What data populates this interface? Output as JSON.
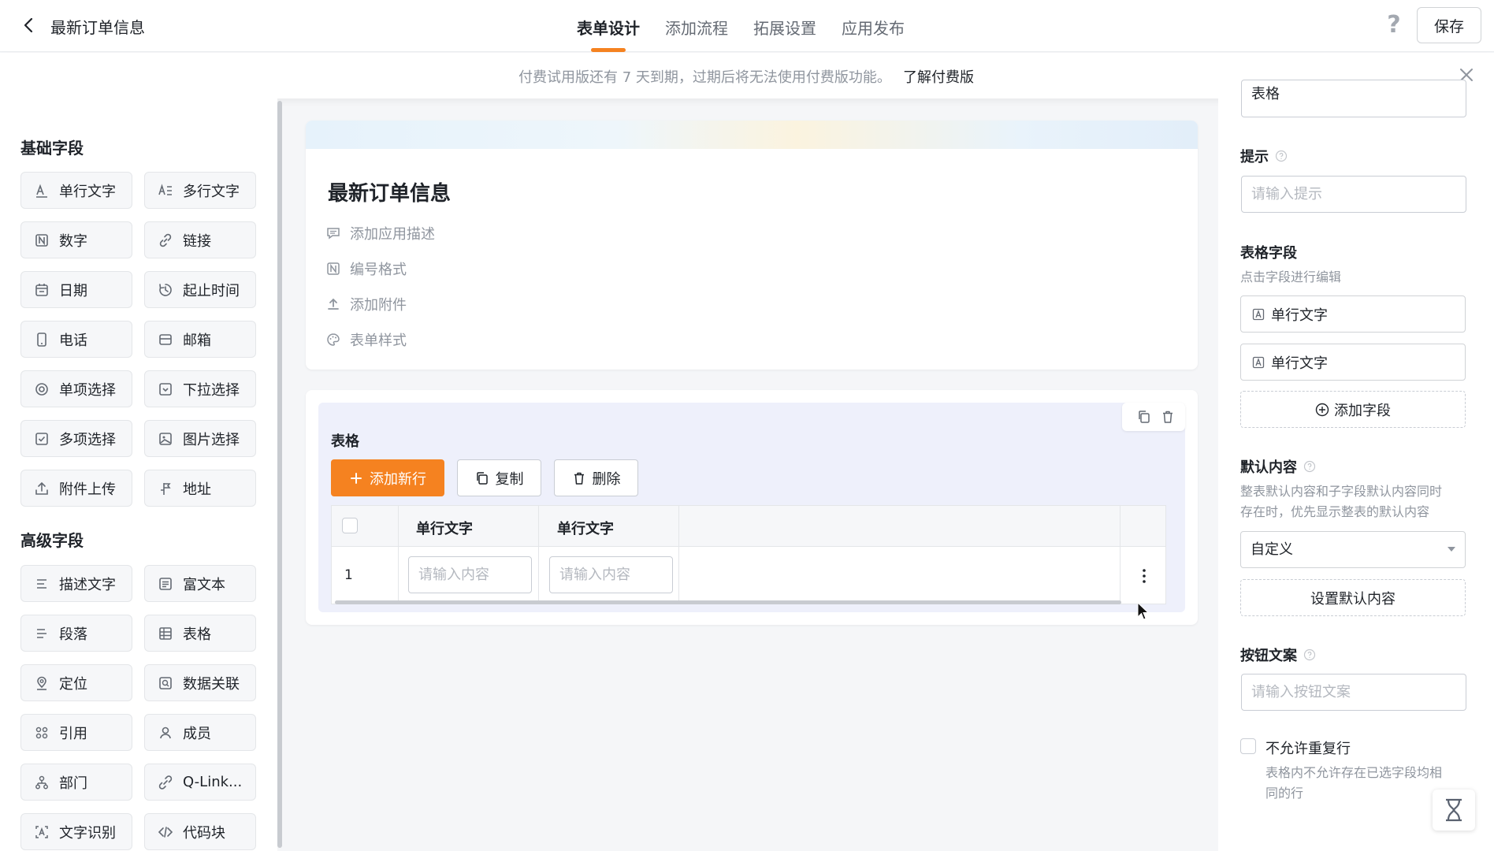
{
  "header": {
    "title": "最新订单信息",
    "tabs": [
      {
        "label": "表单设计",
        "active": true
      },
      {
        "label": "添加流程",
        "active": false
      },
      {
        "label": "拓展设置",
        "active": false
      },
      {
        "label": "应用发布",
        "active": false
      }
    ],
    "help": "?",
    "save_label": "保存"
  },
  "banner": {
    "text": "付费试用版还有 7 天到期，过期后将无法使用付费版功能。",
    "link": "了解付费版"
  },
  "sidebar": {
    "basic_title": "基础字段",
    "basic_fields": [
      {
        "label": "单行文字",
        "icon": "text-a-icon"
      },
      {
        "label": "多行文字",
        "icon": "multiline-text-icon"
      },
      {
        "label": "数字",
        "icon": "number-icon"
      },
      {
        "label": "链接",
        "icon": "link-icon"
      },
      {
        "label": "日期",
        "icon": "calendar-icon"
      },
      {
        "label": "起止时间",
        "icon": "clock-range-icon"
      },
      {
        "label": "电话",
        "icon": "phone-icon"
      },
      {
        "label": "邮箱",
        "icon": "mail-icon"
      },
      {
        "label": "单项选择",
        "icon": "radio-icon"
      },
      {
        "label": "下拉选择",
        "icon": "dropdown-icon"
      },
      {
        "label": "多项选择",
        "icon": "checkbox-icon"
      },
      {
        "label": "图片选择",
        "icon": "image-icon"
      },
      {
        "label": "附件上传",
        "icon": "upload-icon"
      },
      {
        "label": "地址",
        "icon": "address-icon"
      }
    ],
    "advanced_title": "高级字段",
    "advanced_fields": [
      {
        "label": "描述文字",
        "icon": "description-icon"
      },
      {
        "label": "富文本",
        "icon": "rich-text-icon"
      },
      {
        "label": "段落",
        "icon": "paragraph-icon"
      },
      {
        "label": "表格",
        "icon": "table-icon"
      },
      {
        "label": "定位",
        "icon": "location-icon"
      },
      {
        "label": "数据关联",
        "icon": "data-link-icon"
      },
      {
        "label": "引用",
        "icon": "reference-icon"
      },
      {
        "label": "成员",
        "icon": "member-icon"
      },
      {
        "label": "部门",
        "icon": "department-icon"
      },
      {
        "label": "Q-Link...",
        "icon": "q-link-icon"
      },
      {
        "label": "文字识别",
        "icon": "ocr-icon"
      },
      {
        "label": "代码块",
        "icon": "code-icon"
      }
    ]
  },
  "form": {
    "title": "最新订单信息",
    "options": [
      "添加应用描述",
      "编号格式",
      "添加附件",
      "表单样式"
    ]
  },
  "table_widget": {
    "label": "表格",
    "add_row": "添加新行",
    "copy": "复制",
    "delete": "删除",
    "columns": [
      "单行文字",
      "单行文字"
    ],
    "rows": [
      {
        "num": "1",
        "placeholders": [
          "请输入内容",
          "请输入内容"
        ]
      }
    ]
  },
  "right_panel": {
    "top_input_value": "表格",
    "hint_label": "提示",
    "hint_placeholder": "请输入提示",
    "table_fields_label": "表格字段",
    "table_fields_sub": "点击字段进行编辑",
    "table_fields": [
      "单行文字",
      "单行文字"
    ],
    "add_field": "添加字段",
    "default_label": "默认内容",
    "default_desc_1": "整表默认内容和子字段默认内容同时",
    "default_desc_2": "存在时，优先显示整表的默认内容",
    "default_select": "自定义",
    "set_default": "设置默认内容",
    "button_text_label": "按钮文案",
    "button_text_placeholder": "请输入按钮文案",
    "no_dup_label": "不允许重复行",
    "no_dup_desc_1": "表格内不允许存在已选字段均相",
    "no_dup_desc_2": "同的行"
  },
  "colors": {
    "accent": "#f58220",
    "text": "#1f2329",
    "muted": "#8f959e",
    "canvas": "#f5f6f8"
  }
}
